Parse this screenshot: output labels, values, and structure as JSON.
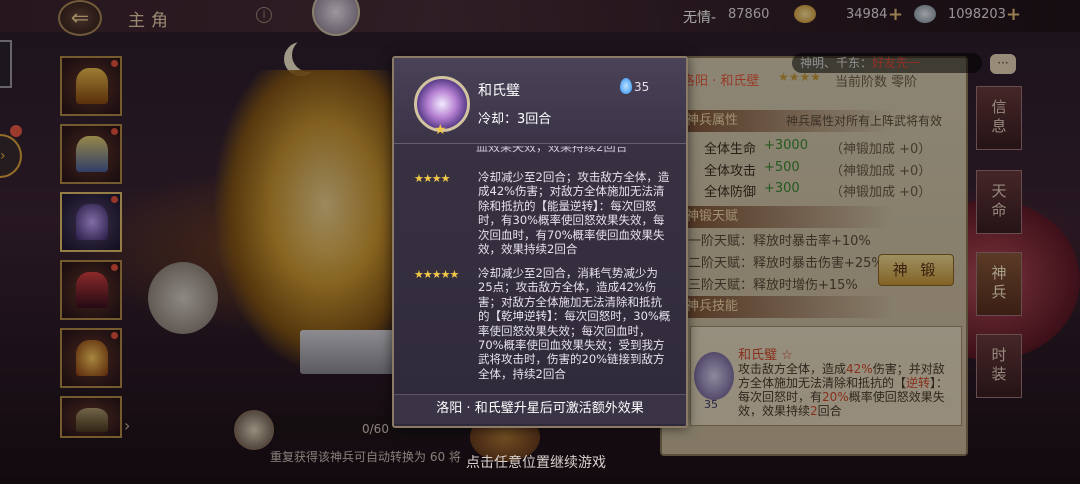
{
  "header": {
    "screen_title": "主角",
    "player_name": "无情-",
    "resources": [
      {
        "icon": "coin-icon",
        "value": "87860"
      },
      {
        "icon": "gold-ingot-icon",
        "value": "34984"
      },
      {
        "icon": "silver-coin-icon",
        "value": "1098203"
      }
    ]
  },
  "marquee": {
    "prefix": "神明、千东",
    "highlight": "好友先一"
  },
  "equipment_slots": [
    "weapon",
    "sword",
    "skill-orb",
    "spear",
    "beast",
    "lock"
  ],
  "crafting": {
    "count": "0/60",
    "hint": "重复获得该神兵可自动转换为 60 将"
  },
  "right_panel": {
    "title": "洛阳 · 和氏壁",
    "stars": "★★★★",
    "stage": "当前阶数 零阶",
    "attr_section": "神兵属性",
    "attr_note": "神兵属性对所有上阵武将有效",
    "stats": [
      {
        "label": "全体生命",
        "value": "+3000",
        "bonus": "（神锻加成 +0）"
      },
      {
        "label": "全体攻击",
        "value": "+500",
        "bonus": "（神锻加成 +0）"
      },
      {
        "label": "全体防御",
        "value": "+300",
        "bonus": "（神锻加成 +0）"
      }
    ],
    "talent_section": "神锻天赋",
    "talents": [
      "一阶天赋：释放时暴击率+10%",
      "二阶天赋：释放时暴击伤害+25%",
      "三阶天赋：释放时增伤+15%"
    ],
    "forge_button": "神 锻",
    "skill_section": "神兵技能",
    "skill_name": "和氏璧 ☆",
    "skill_desc_parts": [
      "攻击敌方全体，造成",
      "42%",
      "伤害；并对敌方全体施加无法清除和抵抗的【",
      "逆转",
      "】：每次回怒时，有",
      "20%",
      "概率使回怒效果失效，效果持续",
      "2",
      "回合"
    ],
    "skill_cost": "35"
  },
  "tabs": [
    "信息",
    "天命",
    "神兵",
    "时装"
  ],
  "popup": {
    "name": "和氏璧",
    "cost": "35",
    "cooldown": "冷却：3回合",
    "cut_text": "血效果失效，效果持续2回合",
    "tiers": [
      {
        "stars": "★★★★",
        "text": "冷却减少至2回合；攻击敌方全体，造成42%伤害；对敌方全体施加无法清除和抵抗的【能量逆转】：每次回怒时，有30%概率使回怒效果失效，每次回血时，有70%概率使回血效果失效，效果持续2回合"
      },
      {
        "stars": "★★★★★",
        "text": "冷却减少至2回合，消耗气势减少为25点；攻击敌方全体，造成42%伤害；对敌方全体施加无法清除和抵抗的【乾坤逆转】：每次回怒时，30%概率使回怒效果失效；每次回血时，70%概率使回血效果失效；受到我方武将攻击时，伤害的20%链接到敌方全体，持续2回合"
      }
    ],
    "footer": "洛阳 · 和氏璧升星后可激活额外效果"
  },
  "continue_hint": "点击任意位置继续游戏"
}
